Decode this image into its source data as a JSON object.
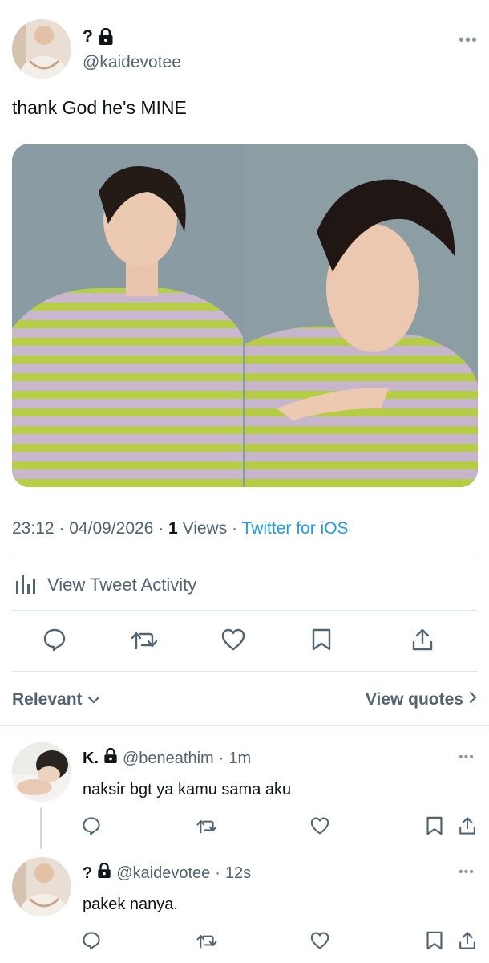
{
  "tweet": {
    "author_name": "?",
    "author_handle": "@kaidevotee",
    "text": "thank God he's MINE",
    "time": "23:12",
    "date": "04/09/2026",
    "views_count": "1",
    "views_label": "Views",
    "source": "Twitter for iOS",
    "separator": "·"
  },
  "activity": {
    "label": "View Tweet Activity"
  },
  "actions": [
    "reply-icon",
    "retweet-icon",
    "like-icon",
    "bookmark-icon",
    "share-icon"
  ],
  "sort": {
    "label": "Relevant",
    "quotes_label": "View quotes"
  },
  "replies": [
    {
      "name": "K.",
      "handle": "@beneathim",
      "time": "1m",
      "text": "naksir bgt ya kamu sama aku"
    },
    {
      "name": "?",
      "handle": "@kaidevotee",
      "time": "12s",
      "text": "pakek nanya."
    }
  ],
  "colors": {
    "accent": "#1d9bf0",
    "muted": "#536471",
    "text": "#0f1419",
    "divider": "#e1e6ea"
  }
}
